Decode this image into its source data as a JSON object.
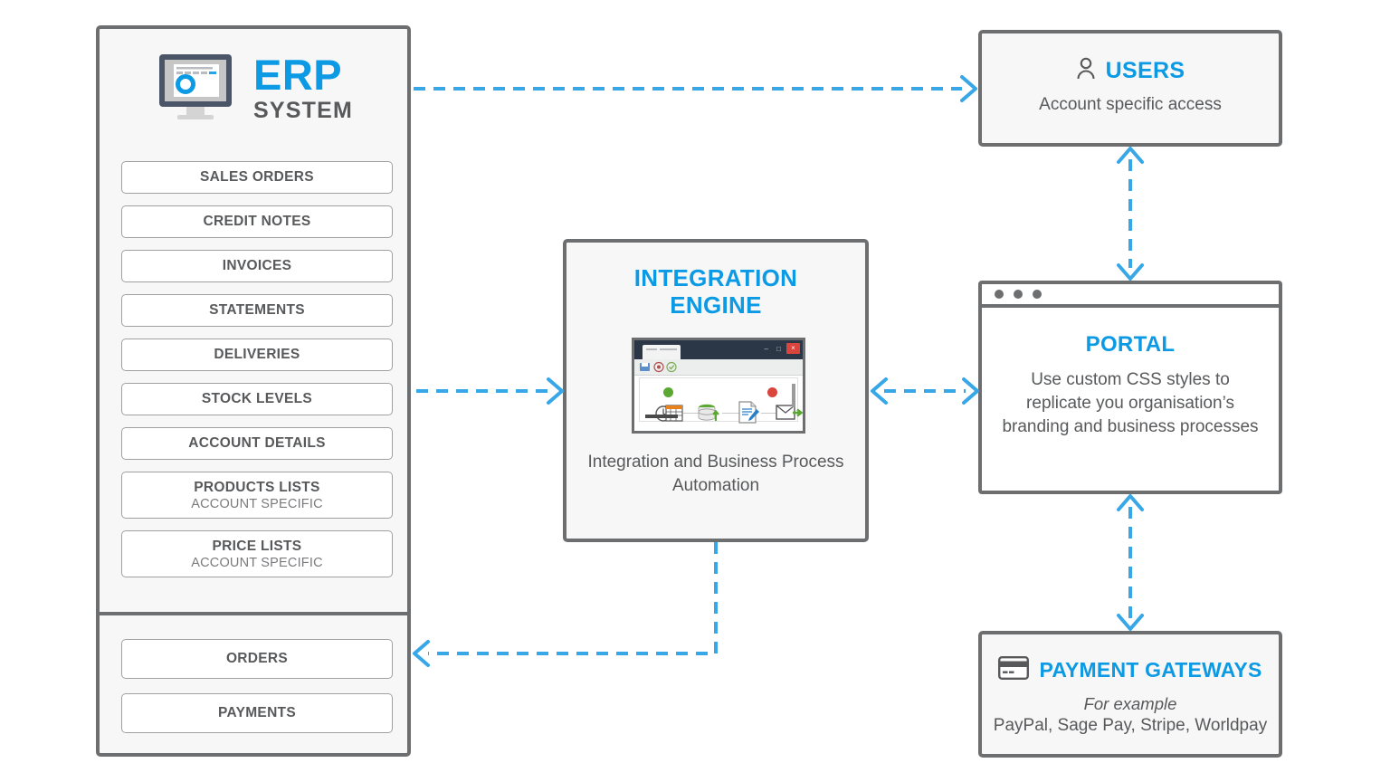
{
  "theme": {
    "accent_blue": "#0c9ae5",
    "arrow_blue": "#37a7e8",
    "border_gray": "#6d6e70",
    "text_gray": "#58595b",
    "panel_bg": "#f7f7f7"
  },
  "erp": {
    "title_main": "ERP",
    "title_sub": "SYSTEM",
    "icon": "monitor-icon",
    "items": [
      {
        "label": "SALES ORDERS",
        "sub": ""
      },
      {
        "label": "CREDIT NOTES",
        "sub": ""
      },
      {
        "label": "INVOICES",
        "sub": ""
      },
      {
        "label": "STATEMENTS",
        "sub": ""
      },
      {
        "label": "DELIVERIES",
        "sub": ""
      },
      {
        "label": "STOCK LEVELS",
        "sub": ""
      },
      {
        "label": "ACCOUNT DETAILS",
        "sub": ""
      },
      {
        "label": "PRODUCTS LISTS",
        "sub": "ACCOUNT SPECIFIC"
      },
      {
        "label": "PRICE LISTS",
        "sub": "ACCOUNT SPECIFIC"
      }
    ],
    "inbound_items": [
      {
        "label": "ORDERS"
      },
      {
        "label": "PAYMENTS"
      }
    ]
  },
  "integration": {
    "title_line1": "INTEGRATION",
    "title_line2": "ENGINE",
    "caption": "Integration and Business Process Automation",
    "screenshot": {
      "name": "integration-flow-screenshot",
      "close_label": "×",
      "minimize_label": "–",
      "maximize_label": "□",
      "nodes": [
        "scheduler-clock-calendar-icon",
        "database-upload-icon",
        "document-edit-icon",
        "email-send-icon"
      ],
      "start_dot_color": "#5aa832",
      "end_dot_color": "#d9453d"
    }
  },
  "users": {
    "icon": "person-icon",
    "title": "USERS",
    "subtitle": "Account specific access"
  },
  "portal": {
    "chrome_dots": 3,
    "title": "PORTAL",
    "body": "Use custom CSS styles to replicate you organisation’s branding and business processes"
  },
  "gateways": {
    "icon": "credit-card-icon",
    "title": "PAYMENT GATEWAYS",
    "example_label": "For example",
    "providers": "PayPal, Sage Pay, Stripe, Worldpay"
  },
  "arrows": [
    {
      "name": "arrow-erp-to-users",
      "direction": "right"
    },
    {
      "name": "arrow-erp-to-integration",
      "direction": "right"
    },
    {
      "name": "arrow-integration-to-portal",
      "direction": "both"
    },
    {
      "name": "arrow-users-portal",
      "direction": "both-vertical"
    },
    {
      "name": "arrow-portal-gateways",
      "direction": "both-vertical"
    },
    {
      "name": "arrow-integration-to-erp-inbound",
      "direction": "left-routed"
    }
  ]
}
